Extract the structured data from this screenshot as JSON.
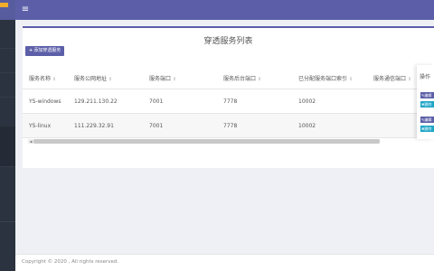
{
  "colors": {
    "accent": "#5c5fa8",
    "sidebar": "#2b3340",
    "delete": "#1fa6c7"
  },
  "topbar": {
    "menu_icon": "menu-icon"
  },
  "card": {
    "title": "穿透服务列表",
    "add_button": "添加穿透服务"
  },
  "table": {
    "columns": [
      "服务名称",
      "服务公网地址",
      "服务端口",
      "服务后台端口",
      "已分配服务端口索引",
      "服务通信端口",
      "操作"
    ],
    "rows": [
      {
        "name": "YS-windows",
        "public_ip": "129.211.130.22",
        "port": "7001",
        "backend_port": "7778",
        "assigned_index": "10002"
      },
      {
        "name": "YS-linux",
        "public_ip": "111.229.32.91",
        "port": "7001",
        "backend_port": "7778",
        "assigned_index": "10002"
      }
    ],
    "actions": {
      "edit": "编辑",
      "delete": "删除"
    }
  },
  "footer": {
    "copyright": "Copyright © 2020 , All rights reserved."
  }
}
